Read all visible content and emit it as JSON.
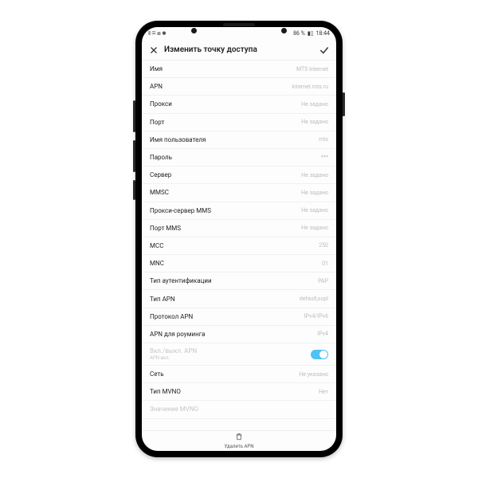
{
  "statusbar": {
    "left_icons": "⫴ ✉ ⧈ ✱",
    "battery_text": "86 %",
    "time": "18:44"
  },
  "titlebar": {
    "title": "Изменить точку доступа"
  },
  "rows": [
    {
      "label": "Имя",
      "value": "MTS Internet"
    },
    {
      "label": "APN",
      "value": "internet.mts.ru"
    },
    {
      "label": "Прокси",
      "value": "Не задано"
    },
    {
      "label": "Порт",
      "value": "Не задано"
    },
    {
      "label": "Имя пользователя",
      "value": "mts"
    },
    {
      "label": "Пароль",
      "value": "***"
    },
    {
      "label": "Сервер",
      "value": "Не задано"
    },
    {
      "label": "MMSC",
      "value": "Не задано"
    },
    {
      "label": "Прокси-сервер MMS",
      "value": "Не задано"
    },
    {
      "label": "Порт MMS",
      "value": "Не задано"
    },
    {
      "label": "MCC",
      "value": "250"
    },
    {
      "label": "MNC",
      "value": "01"
    },
    {
      "label": "Тип аутентификации",
      "value": "PAP"
    },
    {
      "label": "Тип APN",
      "value": "default,supl"
    },
    {
      "label": "Протокол APN",
      "value": "IPv4/IPv6"
    },
    {
      "label": "APN для роуминга",
      "value": "IPv4"
    }
  ],
  "toggle_row": {
    "label": "Вкл./выкл. APN",
    "sub": "APN вкл."
  },
  "rows_after": [
    {
      "label": "Сеть",
      "value": "Не указано"
    },
    {
      "label": "Тип MVNO",
      "value": "Нет"
    }
  ],
  "disabled_row": {
    "label": "Значение MVNO",
    "value": ""
  },
  "bottom": {
    "label": "Удалить APN"
  }
}
